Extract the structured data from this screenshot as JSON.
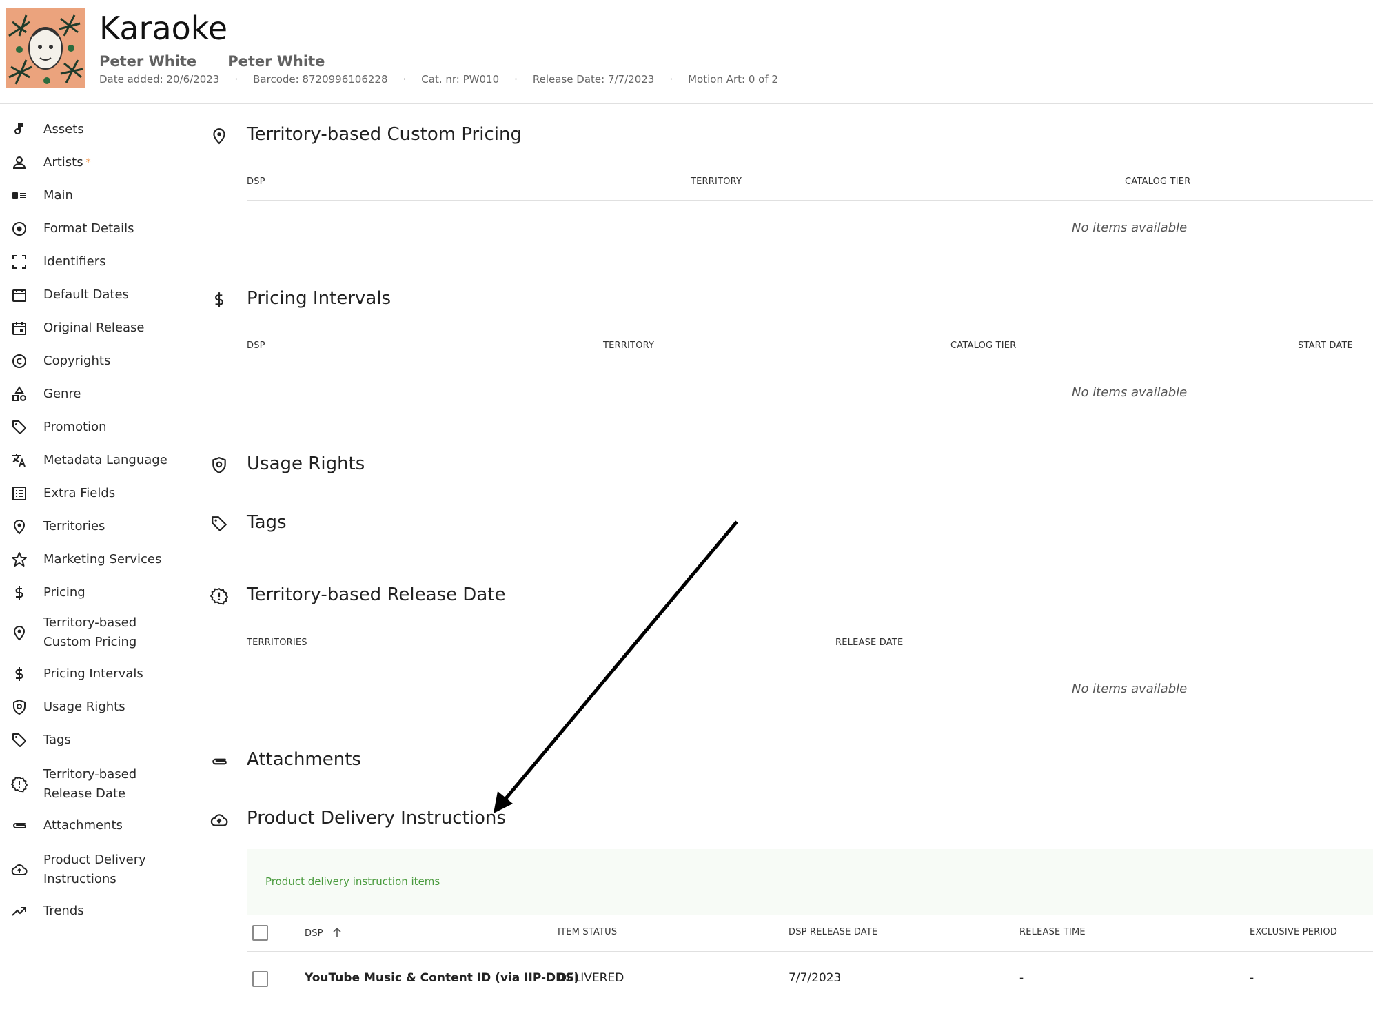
{
  "header": {
    "title": "Karaoke",
    "artist_primary": "Peter White",
    "artist_secondary": "Peter White",
    "date_added": "Date added: 20/6/2023",
    "barcode": "Barcode: 8720996106228",
    "cat_nr": "Cat. nr: PW010",
    "release_date": "Release Date: 7/7/2023",
    "motion_art": "Motion Art: 0 of 2",
    "separator": "·"
  },
  "sidebar": {
    "items": [
      {
        "label": "Assets",
        "icon": "music-note-icon"
      },
      {
        "label": "Artists",
        "icon": "person-icon",
        "required": "*"
      },
      {
        "label": "Main",
        "icon": "card-icon"
      },
      {
        "label": "Format Details",
        "icon": "disc-icon"
      },
      {
        "label": "Identifiers",
        "icon": "frame-corners-icon"
      },
      {
        "label": "Default Dates",
        "icon": "calendar-icon"
      },
      {
        "label": "Original Release",
        "icon": "calendar-event-icon"
      },
      {
        "label": "Copyrights",
        "icon": "copyright-icon"
      },
      {
        "label": "Genre",
        "icon": "shapes-icon"
      },
      {
        "label": "Promotion",
        "icon": "tag-icon"
      },
      {
        "label": "Metadata Language",
        "icon": "translate-icon"
      },
      {
        "label": "Extra Fields",
        "icon": "list-box-icon"
      },
      {
        "label": "Territories",
        "icon": "map-pin-icon"
      },
      {
        "label": "Marketing Services",
        "icon": "star-icon"
      },
      {
        "label": "Pricing",
        "icon": "dollar-icon"
      },
      {
        "label_line1": "Territory-based",
        "label_line2": "Custom Pricing",
        "icon": "map-pin-icon"
      },
      {
        "label": "Pricing Intervals",
        "icon": "dollar-icon"
      },
      {
        "label": "Usage Rights",
        "icon": "shield-icon"
      },
      {
        "label": "Tags",
        "icon": "tag-icon"
      },
      {
        "label_line1": "Territory-based",
        "label_line2": "Release Date",
        "icon": "alert-badge-icon"
      },
      {
        "label": "Attachments",
        "icon": "paperclip-icon"
      },
      {
        "label_line1": "Product Delivery",
        "label_line2": "Instructions",
        "icon": "cloud-upload-icon"
      },
      {
        "label": "Trends",
        "icon": "trending-up-icon"
      }
    ]
  },
  "sections": {
    "custom_pricing": {
      "title": "Territory-based Custom Pricing",
      "columns": [
        "DSP",
        "TERRITORY",
        "CATALOG TIER"
      ],
      "empty": "No items available"
    },
    "pricing_intervals": {
      "title": "Pricing Intervals",
      "columns": [
        "DSP",
        "TERRITORY",
        "CATALOG TIER",
        "START DATE"
      ],
      "empty": "No items available"
    },
    "usage_rights": {
      "title": "Usage Rights"
    },
    "tags": {
      "title": "Tags"
    },
    "release_date": {
      "title": "Territory-based Release Date",
      "columns": [
        "TERRITORIES",
        "RELEASE DATE"
      ],
      "empty": "No items available"
    },
    "attachments": {
      "title": "Attachments"
    },
    "delivery": {
      "title": "Product Delivery Instructions",
      "banner": "Product delivery instruction items",
      "columns": [
        "DSP",
        "ITEM STATUS",
        "DSP RELEASE DATE",
        "RELEASE TIME",
        "EXCLUSIVE PERIOD"
      ],
      "rows": [
        {
          "dsp": "YouTube Music & Content ID (via IIP-DDS)",
          "status": "DELIVERED",
          "release_date": "7/7/2023",
          "release_time": "-",
          "exclusive_period": "-"
        }
      ]
    }
  },
  "colors": {
    "accent_green": "#4a9b3e",
    "required_orange": "#f28c38",
    "divider": "#e0e0e0"
  }
}
